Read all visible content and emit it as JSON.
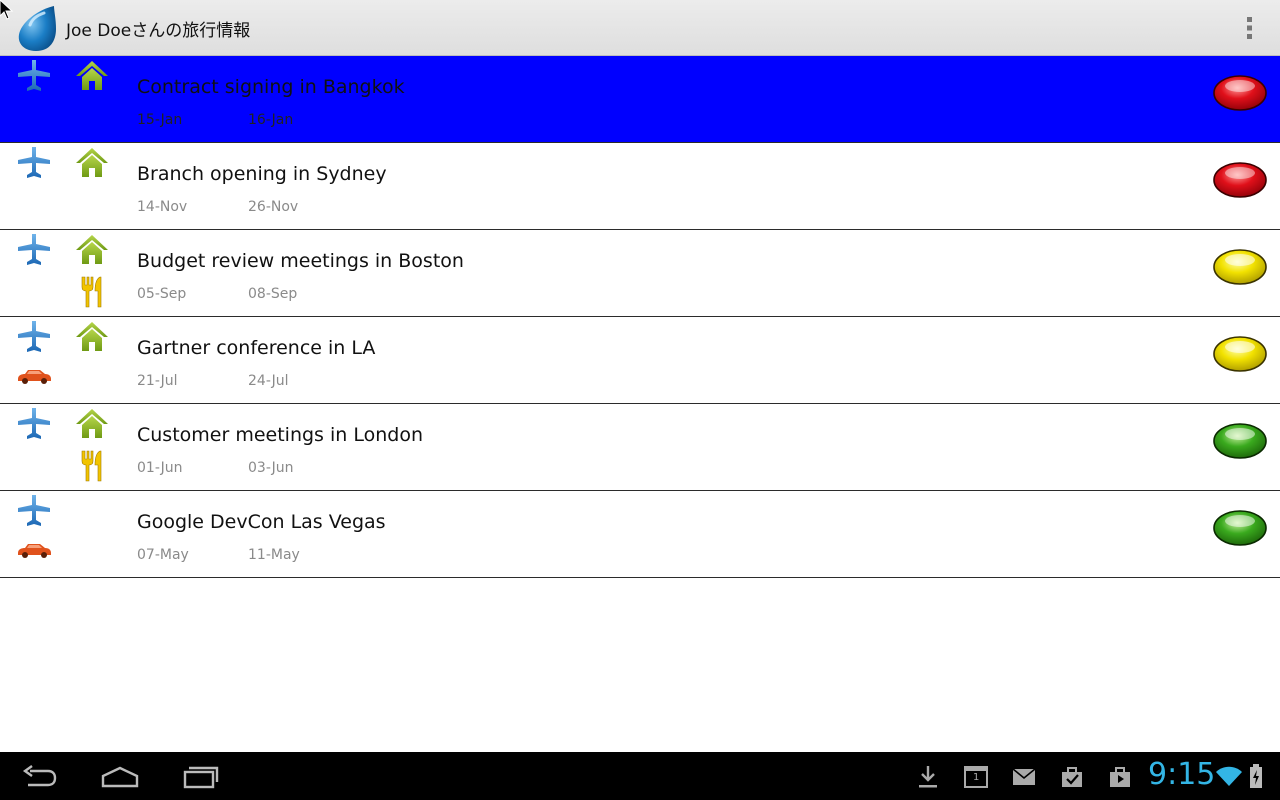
{
  "app": {
    "title": "Joe Doeさんの旅行情報",
    "icon": "blue-drop-icon",
    "menu_icon": "overflow-menu-icon"
  },
  "colors": {
    "selected_row": "#0000ff",
    "status_red": "#e0101a",
    "status_yellow": "#f2e200",
    "status_green": "#3aaa1e",
    "clock": "#33b5e5"
  },
  "trips": [
    {
      "title": "Contract signing in Bangkok",
      "start": "15-Jan",
      "end": "16-Jan",
      "selected": true,
      "icons": [
        "plane-icon",
        "house-icon"
      ],
      "status": "red"
    },
    {
      "title": "Branch opening in Sydney",
      "start": "14-Nov",
      "end": "26-Nov",
      "selected": false,
      "icons": [
        "plane-icon",
        "house-icon"
      ],
      "status": "red"
    },
    {
      "title": "Budget review meetings in Boston",
      "start": "05-Sep",
      "end": "08-Sep",
      "selected": false,
      "icons": [
        "plane-icon",
        "house-icon",
        "food-icon"
      ],
      "status": "yellow"
    },
    {
      "title": "Gartner conference in LA",
      "start": "21-Jul",
      "end": "24-Jul",
      "selected": false,
      "icons": [
        "plane-icon",
        "house-icon",
        "car-icon"
      ],
      "status": "yellow"
    },
    {
      "title": "Customer meetings in London",
      "start": "01-Jun",
      "end": "03-Jun",
      "selected": false,
      "icons": [
        "plane-icon",
        "house-icon",
        "food-icon"
      ],
      "status": "green"
    },
    {
      "title": "Google DevCon Las Vegas",
      "start": "07-May",
      "end": "11-May",
      "selected": false,
      "icons": [
        "plane-icon",
        "car-icon"
      ],
      "status": "green"
    }
  ],
  "system_bar": {
    "clock": "9:15",
    "nav_icons": [
      "back-icon",
      "home-icon",
      "recent-apps-icon"
    ],
    "notification_icons": [
      "download-icon",
      "calendar-icon",
      "mail-icon",
      "task-icon",
      "shop-icon"
    ],
    "calendar_day": "1",
    "status_icons": [
      "wifi-icon",
      "battery-charging-icon"
    ]
  }
}
